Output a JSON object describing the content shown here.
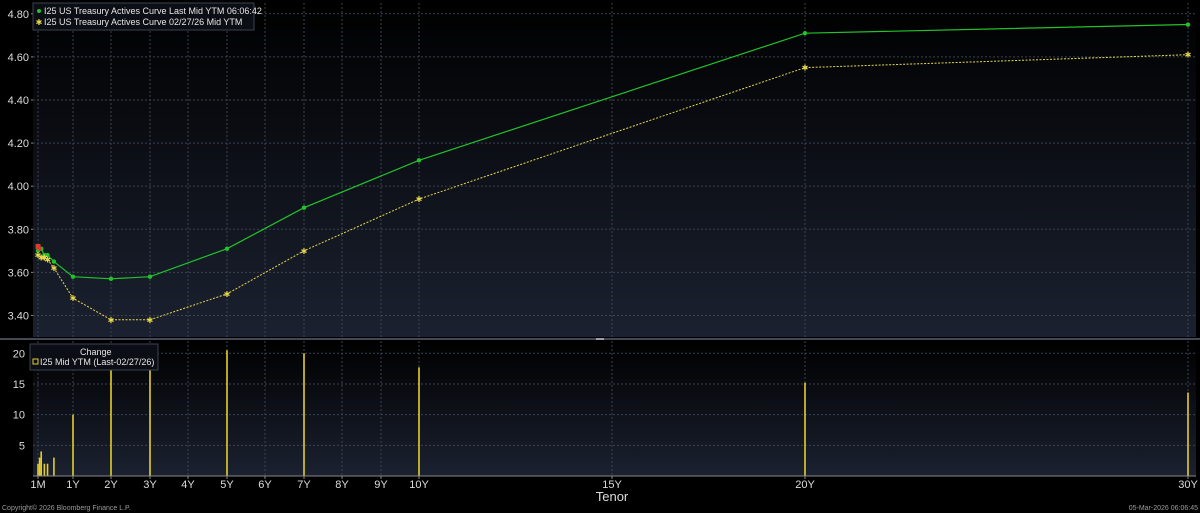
{
  "footer": {
    "copyright": "Copyright© 2026 Bloomberg Finance L.P.",
    "timestamp": "05-Mar-2026 06:06:45"
  },
  "colors": {
    "current": "#22c32a",
    "previous": "#e7d94a",
    "change": "#e4cd2c",
    "marker_red": "#d83a2b",
    "grid": "#3a4250",
    "background_top": "#000000",
    "background_bottom": "#1b2130"
  },
  "chart_data": [
    {
      "type": "line",
      "grid": true,
      "legend_position": "top-left",
      "ylim": [
        3.3,
        4.85
      ],
      "y_ticks": [
        3.4,
        3.6,
        3.8,
        4.0,
        4.2,
        4.4,
        4.6,
        4.8
      ],
      "y_tick_labels": [
        "3.40",
        "3.60",
        "3.80",
        "4.00",
        "4.20",
        "4.40",
        "4.60",
        "4.80"
      ],
      "series": [
        {
          "name": "I25 US Treasury Actives Curve Last Mid YTM 06:06:42",
          "x_years": [
            0.083,
            0.167,
            0.25,
            0.333,
            0.5,
            1,
            2,
            3,
            5,
            7,
            10,
            20,
            30
          ],
          "values": [
            3.7,
            3.71,
            3.68,
            3.68,
            3.65,
            3.58,
            3.57,
            3.58,
            3.71,
            3.9,
            4.12,
            4.71,
            4.75
          ]
        },
        {
          "name": "I25 US Treasury Actives Curve 02/27/26 Mid YTM",
          "x_years": [
            0.083,
            0.167,
            0.25,
            0.333,
            0.5,
            1,
            2,
            3,
            5,
            7,
            10,
            20,
            30
          ],
          "values": [
            3.68,
            3.67,
            3.67,
            3.66,
            3.62,
            3.48,
            3.38,
            3.38,
            3.5,
            3.7,
            3.94,
            4.55,
            4.61
          ]
        }
      ]
    },
    {
      "type": "bar",
      "title": "Change",
      "legend_position": "top-left",
      "ylim": [
        0,
        22
      ],
      "y_ticks": [
        5,
        10,
        15,
        20
      ],
      "y_tick_labels": [
        "5",
        "10",
        "15",
        "20"
      ],
      "series": [
        {
          "name": "I25 Mid YTM (Last-02/27/26)",
          "x_years": [
            0.083,
            0.125,
            0.167,
            0.25,
            0.333,
            0.5,
            1,
            2,
            3,
            5,
            7,
            10,
            20,
            30
          ],
          "values": [
            2.0,
            3.0,
            4.0,
            2.0,
            2.0,
            3.0,
            10.0,
            19.0,
            20.0,
            20.5,
            20.0,
            17.7,
            15.2,
            13.6
          ]
        }
      ]
    }
  ],
  "x_axis": {
    "label": "Tenor",
    "ticks": [
      {
        "label": "1M",
        "years": 0.083
      },
      {
        "label": "1Y",
        "years": 1
      },
      {
        "label": "2Y",
        "years": 2
      },
      {
        "label": "3Y",
        "years": 3
      },
      {
        "label": "4Y",
        "years": 4
      },
      {
        "label": "5Y",
        "years": 5
      },
      {
        "label": "6Y",
        "years": 6
      },
      {
        "label": "7Y",
        "years": 7
      },
      {
        "label": "8Y",
        "years": 8
      },
      {
        "label": "9Y",
        "years": 9
      },
      {
        "label": "10Y",
        "years": 10
      },
      {
        "label": "15Y",
        "years": 15
      },
      {
        "label": "20Y",
        "years": 20
      },
      {
        "label": "30Y",
        "years": 30
      }
    ]
  }
}
